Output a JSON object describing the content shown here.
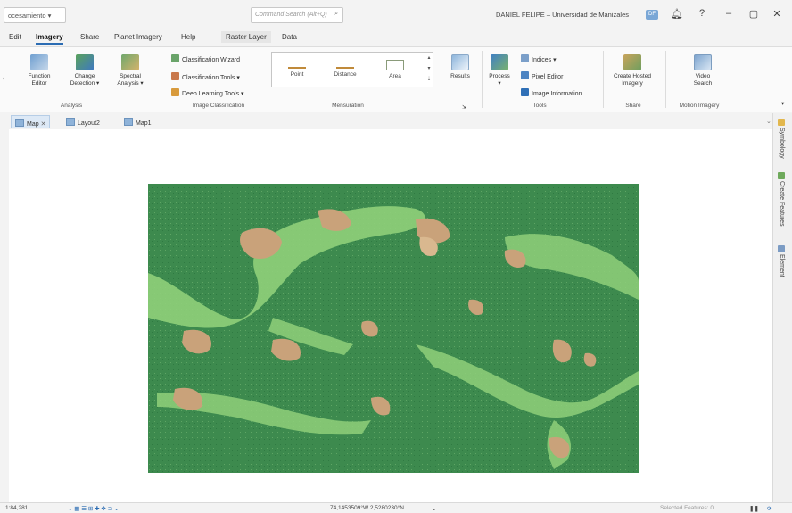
{
  "titlebar": {
    "project_dropdown": "ocesamiento ▾",
    "command_search_placeholder": "Command Search (Alt+Q)",
    "user_name": "DANIEL FELIPE",
    "org": "Universidad de Manizales",
    "user_initials": "DF",
    "min": "–",
    "restore": "▢",
    "close": "✕",
    "bell": "♫",
    "help": "?"
  },
  "menubar": {
    "items": [
      "Edit",
      "Imagery",
      "Share",
      "Planet Imagery",
      "Help",
      "Raster Layer",
      "Data"
    ]
  },
  "ribbon": {
    "analysis": {
      "label": "Analysis",
      "function_editor": [
        "Function",
        "Editor"
      ],
      "change_detection": [
        "Change",
        "Detection ▾"
      ],
      "spectral_analysis": [
        "Spectral",
        "Analysis ▾"
      ]
    },
    "image_classification": {
      "label": "Image Classification",
      "wizard": "Classification Wizard",
      "tools": "Classification Tools ▾",
      "deep_learning": "Deep Learning Tools ▾"
    },
    "mensuration": {
      "label": "Mensuration",
      "point": "Point",
      "distance": "Distance",
      "area": "Area",
      "results": "Results"
    },
    "tools": {
      "label": "Tools",
      "process": "Process",
      "indices": "Indices ▾",
      "pixel_editor": "Pixel Editor",
      "image_information": "Image Information"
    },
    "share": {
      "label": "Share",
      "create_hosted": [
        "Create Hosted",
        "Imagery"
      ]
    },
    "motion": {
      "label": "Motion Imagery",
      "video_search": [
        "Video",
        "Search"
      ]
    }
  },
  "tabs": [
    "Map",
    "Layout2",
    "Map1"
  ],
  "side_tabs": [
    "Symbology",
    "Create Features",
    "Element"
  ],
  "status": {
    "scale": "1:84,281",
    "coords": "74,1453509°W 2,5280230°N",
    "selected": "Selected Features: 0"
  },
  "colors": {
    "accent": "#2b6cb3",
    "forest": "#3d8a4e",
    "light_green": "#8fcf7a",
    "bare_soil": "#c9a27a"
  }
}
